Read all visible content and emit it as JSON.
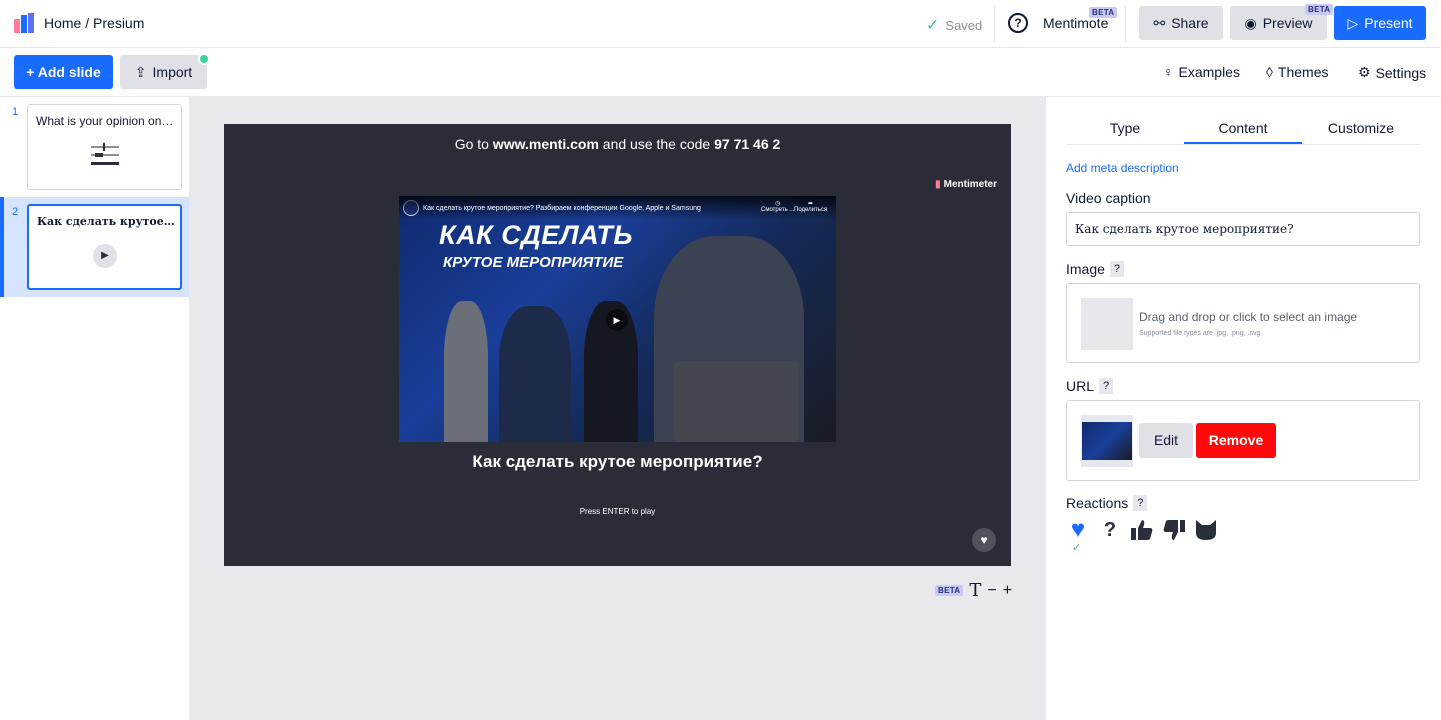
{
  "header": {
    "breadcrumb_home": "Home",
    "breadcrumb_sep": "/",
    "breadcrumb_current": "Presium",
    "saved_label": "Saved",
    "mentimote_label": "Mentimote",
    "beta_label": "BETA",
    "share_label": "Share",
    "preview_label": "Preview",
    "present_label": "Present"
  },
  "toolbar": {
    "add_slide_label": "+ Add slide",
    "import_label": "Import",
    "examples_label": "Examples",
    "themes_label": "Themes",
    "settings_label": "Settings"
  },
  "slides": [
    {
      "number": "1",
      "title": "What is your opinion on t...",
      "icon": "sliders-icon"
    },
    {
      "number": "2",
      "title": "Как сделать крутое мер...",
      "icon": "play-icon",
      "active": true
    }
  ],
  "slide": {
    "join_prefix": "Go to",
    "join_url": "www.menti.com",
    "join_mid": "and use the code",
    "join_code": "97 71 46 2",
    "brand": "Mentimeter",
    "video_title_bar": "Как сделать крутое мероприятие? Разбираем конференции Google, Apple и Samsung",
    "video_watch_later": "Смотреть ...",
    "video_share": "Поделиться",
    "video_headline_1": "КАК СДЕЛАТЬ",
    "video_headline_2": "КРУТОЕ МЕРОПРИЯТИЕ",
    "caption": "Как сделать крутое мероприятие?",
    "press_enter": "Press ENTER to play"
  },
  "text_tools": {
    "beta": "BETA",
    "text_icon": "T",
    "minus": "−",
    "plus": "+"
  },
  "panel": {
    "tabs": [
      "Type",
      "Content",
      "Customize"
    ],
    "active_tab": "Content",
    "meta_link": "Add meta description",
    "video_caption_label": "Video caption",
    "video_caption_value": "Как сделать крутое мероприятие?",
    "image_label": "Image",
    "image_drop_text": "Drag and drop or click to select an image",
    "image_supported": "Supported file types are .jpg, .png, .svg",
    "url_label": "URL",
    "edit_label": "Edit",
    "remove_label": "Remove",
    "reactions_label": "Reactions",
    "help_mark": "?",
    "reactions": [
      "heart-icon",
      "question-icon",
      "thumbs-up-icon",
      "thumbs-down-icon",
      "cat-icon"
    ]
  },
  "colors": {
    "accent": "#196cff",
    "remove": "#ff0a0a",
    "saved_check": "#3bbf8e",
    "slide_bg": "#2a2d37"
  }
}
